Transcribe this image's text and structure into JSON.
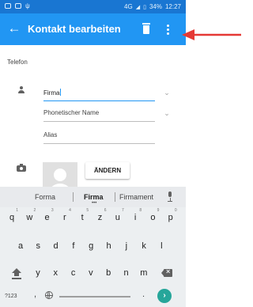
{
  "status_bar": {
    "network": "4G",
    "battery": "34%",
    "time": "12:27"
  },
  "app_bar": {
    "title": "Kontakt bearbeiten"
  },
  "form": {
    "section_label": "Telefon",
    "company_value": "Firma",
    "phonetic_placeholder": "Phonetischer Name",
    "alias_placeholder": "Alias",
    "change_button": "ÄNDERN"
  },
  "keyboard": {
    "suggestions": [
      "Forma",
      "Firma",
      "Firmament"
    ],
    "row1": [
      {
        "k": "q",
        "h": "1"
      },
      {
        "k": "w",
        "h": "2"
      },
      {
        "k": "e",
        "h": "3"
      },
      {
        "k": "r",
        "h": "4"
      },
      {
        "k": "t",
        "h": "5"
      },
      {
        "k": "z",
        "h": "6"
      },
      {
        "k": "u",
        "h": "7"
      },
      {
        "k": "i",
        "h": "8"
      },
      {
        "k": "o",
        "h": "9"
      },
      {
        "k": "p",
        "h": "0"
      }
    ],
    "row2": [
      "a",
      "s",
      "d",
      "f",
      "g",
      "h",
      "j",
      "k",
      "l"
    ],
    "row3": [
      "y",
      "x",
      "c",
      "v",
      "b",
      "n",
      "m"
    ],
    "sym_label": "?123",
    "comma_label": ",",
    "period_label": ".",
    "go_label": "›"
  },
  "icons": {
    "back": "arrow-back-icon",
    "delete": "trash-icon",
    "overflow": "more-vert-icon",
    "name_field": "person-icon",
    "photo_field": "camera-icon",
    "dropdown": "chevron-down-icon",
    "mic": "mic-icon",
    "shift": "shift-icon",
    "backspace": "backspace-icon",
    "language": "globe-icon"
  },
  "colors": {
    "app_bar": "#2196f3",
    "status_bar": "#1976d2",
    "accent": "#2196f3",
    "annotation_arrow": "#e53935",
    "go_key": "#26a69a"
  }
}
